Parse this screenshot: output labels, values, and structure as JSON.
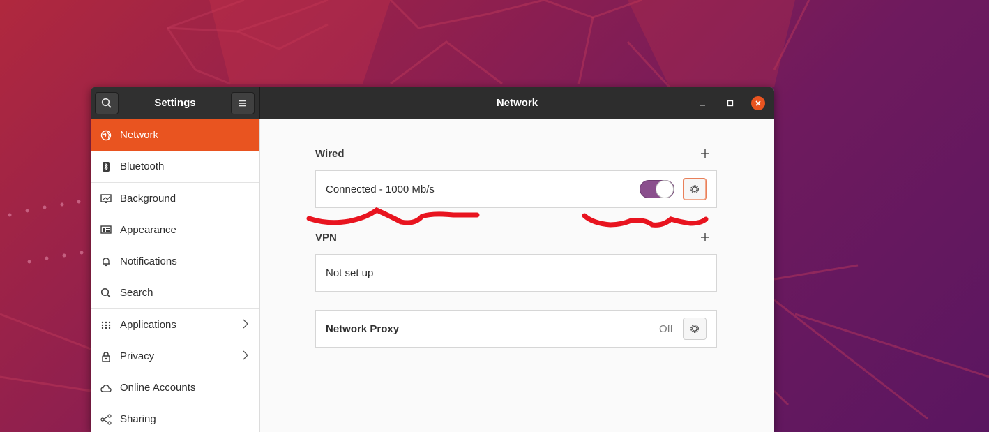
{
  "titlebar": {
    "left_title": "Settings",
    "main_title": "Network"
  },
  "sidebar": {
    "items": [
      {
        "label": "Network",
        "icon": "network-icon",
        "active": true
      },
      {
        "label": "Bluetooth",
        "icon": "bluetooth-icon"
      },
      {
        "label": "Background",
        "icon": "background-icon"
      },
      {
        "label": "Appearance",
        "icon": "appearance-icon"
      },
      {
        "label": "Notifications",
        "icon": "bell-icon"
      },
      {
        "label": "Search",
        "icon": "search-icon"
      },
      {
        "label": "Applications",
        "icon": "apps-grid-icon",
        "has_submenu": true
      },
      {
        "label": "Privacy",
        "icon": "lock-icon",
        "has_submenu": true
      },
      {
        "label": "Online Accounts",
        "icon": "cloud-icon"
      },
      {
        "label": "Sharing",
        "icon": "share-icon"
      }
    ]
  },
  "wired": {
    "title": "Wired",
    "status": "Connected - 1000 Mb/s",
    "enabled": true
  },
  "vpn": {
    "title": "VPN",
    "status": "Not set up"
  },
  "proxy": {
    "title": "Network Proxy",
    "state": "Off"
  },
  "colors": {
    "accent": "#e95420",
    "toggle_on": "#8a4f8d",
    "titlebar": "#2d2d2d",
    "annotation": "#e8141f"
  }
}
